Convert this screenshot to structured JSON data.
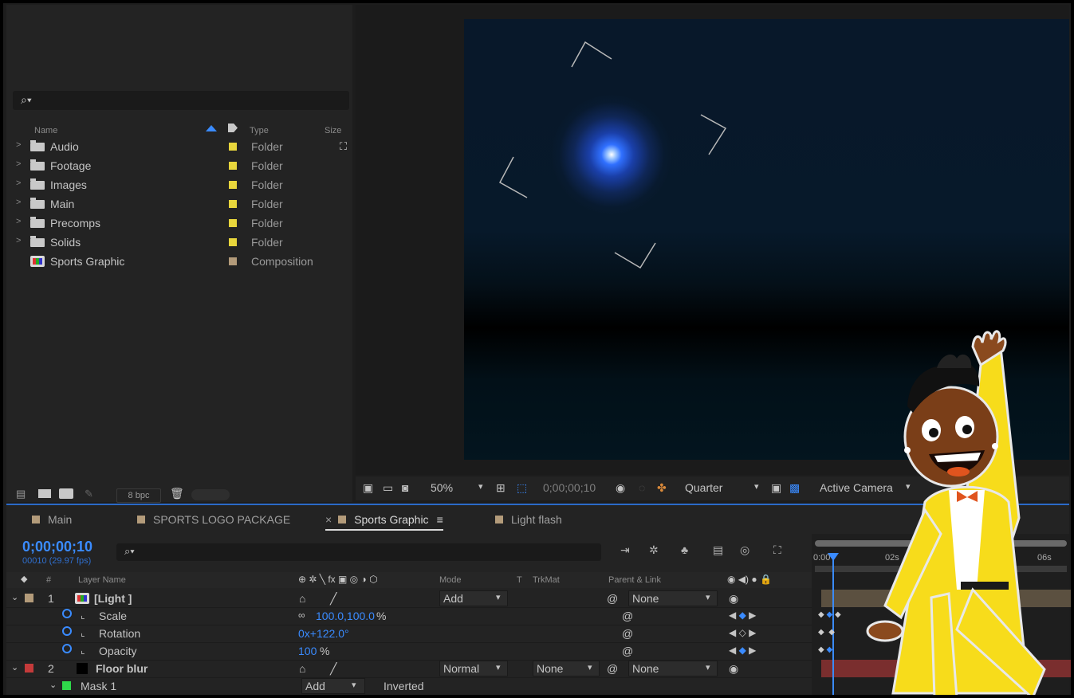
{
  "project": {
    "search_glyph": "⌕▾",
    "columns": {
      "name": "Name",
      "type": "Type",
      "size": "Size"
    },
    "items": [
      {
        "name": "Audio",
        "type": "Folder",
        "label_color": "#e8d63c",
        "kind": "folder"
      },
      {
        "name": "Footage",
        "type": "Folder",
        "label_color": "#e8d63c",
        "kind": "folder"
      },
      {
        "name": "Images",
        "type": "Folder",
        "label_color": "#e8d63c",
        "kind": "folder"
      },
      {
        "name": "Main",
        "type": "Folder",
        "label_color": "#e8d63c",
        "kind": "folder"
      },
      {
        "name": "Precomps",
        "type": "Folder",
        "label_color": "#e8d63c",
        "kind": "folder"
      },
      {
        "name": "Solids",
        "type": "Folder",
        "label_color": "#e8d63c",
        "kind": "folder"
      },
      {
        "name": "Sports Graphic",
        "type": "Composition",
        "label_color": "#b39b7a",
        "kind": "composition"
      }
    ],
    "bpc": "8 bpc"
  },
  "viewer": {
    "zoom": "50%",
    "timecode": "0;00;00;10",
    "resolution": "Quarter",
    "camera": "Active Camera"
  },
  "timeline": {
    "tabs": [
      {
        "label": "Main",
        "active": false
      },
      {
        "label": "SPORTS LOGO PACKAGE",
        "active": false
      },
      {
        "label": "Sports Graphic",
        "active": true
      },
      {
        "label": "Light flash",
        "active": false
      }
    ],
    "timecode": "0;00;00;10",
    "fps": "00010 (29.97 fps)",
    "columns": {
      "num": "#",
      "layer_name": "Layer Name",
      "mode": "Mode",
      "t": "T",
      "trkmat": "TrkMat",
      "parent": "Parent & Link"
    },
    "ruler": [
      "0:00",
      "02s",
      "06s"
    ],
    "layers": [
      {
        "num": "1",
        "name": "[Light ]",
        "label_color": "#b39b7a",
        "mode": "Add",
        "parent": "None"
      },
      {
        "num": "2",
        "name": "Floor blur",
        "label_color": "#c43a3a",
        "mode": "Normal",
        "trkmat": "None",
        "parent": "None"
      }
    ],
    "properties": [
      {
        "name": "Scale",
        "value": "100.0,100.0",
        "unit": "%"
      },
      {
        "name": "Rotation",
        "value": "0x+122.0°",
        "unit": ""
      },
      {
        "name": "Opacity",
        "value": "100",
        "unit": "%"
      }
    ],
    "mask": {
      "name": "Mask 1",
      "mode": "Add",
      "inverted_label": "Inverted"
    }
  },
  "colors": {
    "accent": "#3a8bff",
    "folder_label": "#e8d63c",
    "comp_label": "#b39b7a",
    "layer2_label": "#c43a3a"
  }
}
